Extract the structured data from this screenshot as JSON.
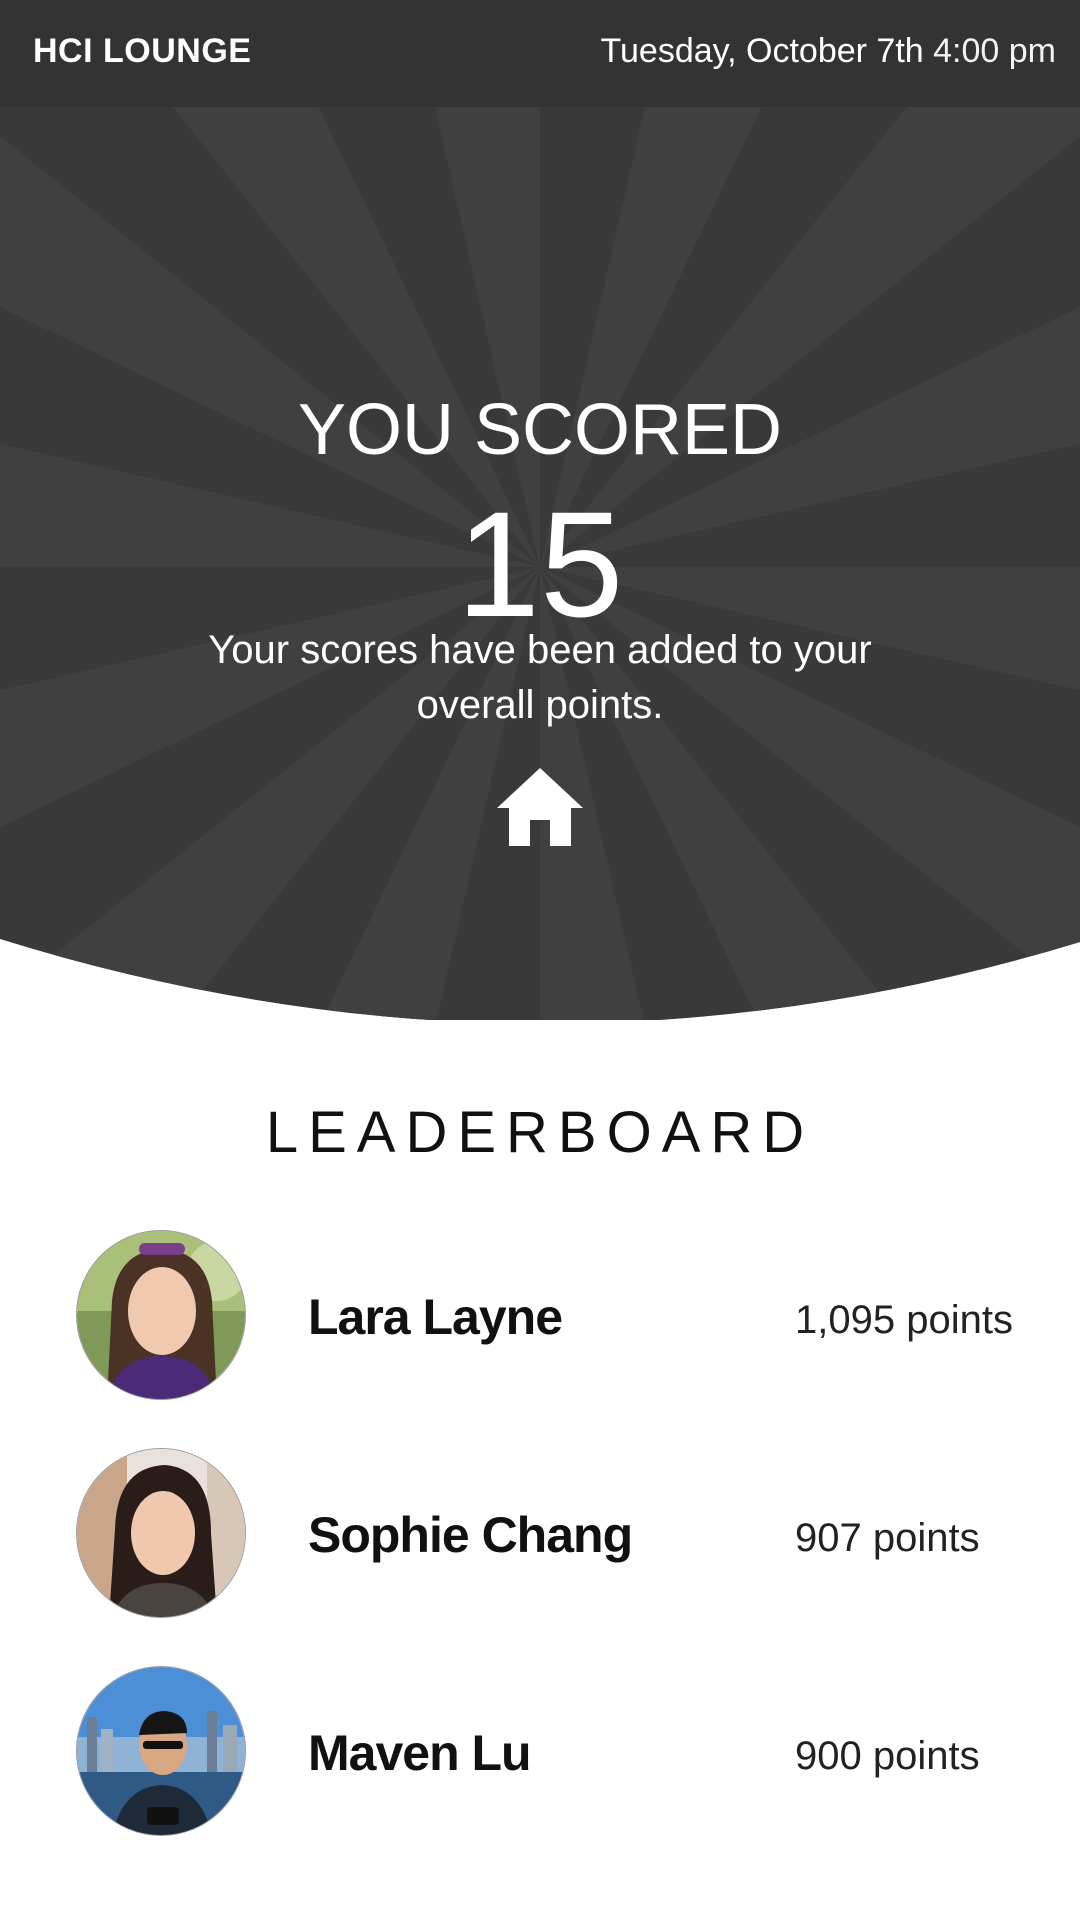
{
  "header": {
    "brand": "HCI LOUNGE",
    "date": "Tuesday, October 7th",
    "time": "4:00 pm"
  },
  "result": {
    "label": "YOU SCORED",
    "score": "15",
    "message": "Your scores have been added to your overall points."
  },
  "home": {
    "icon": "home-icon"
  },
  "leaderboard": {
    "title": "LEADERBOARD",
    "entries": [
      {
        "name": "Lara Layne",
        "points": "1,095 points"
      },
      {
        "name": "Sophie Chang",
        "points": "907 points"
      },
      {
        "name": "Maven Lu",
        "points": "900 points"
      }
    ]
  },
  "colors": {
    "header_bg": "#333333",
    "hero_bg": "#3a3a3a",
    "hero_ray": "#404040",
    "text_light": "#ffffff",
    "text_dark": "#111111"
  }
}
